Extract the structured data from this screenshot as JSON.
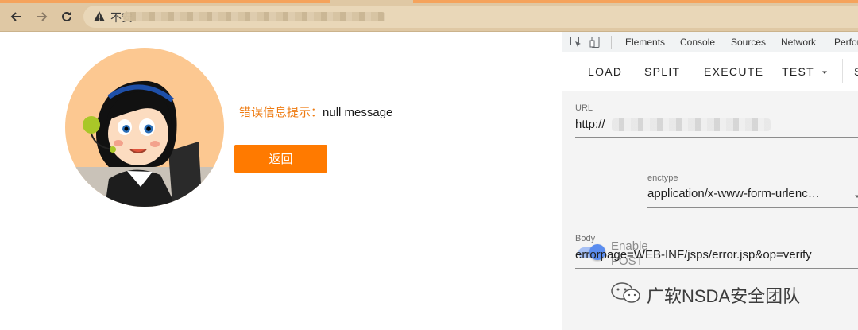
{
  "browser": {
    "back_icon": "arrow-left-icon",
    "forward_icon": "arrow-right-icon",
    "reload_icon": "reload-icon",
    "security_icon": "warning-icon",
    "security_label": "不安"
  },
  "page": {
    "error_label": "错误信息提示：",
    "error_message": "null message",
    "back_button": "返回"
  },
  "devtools": {
    "tabs": [
      "Elements",
      "Console",
      "Sources",
      "Network",
      "Perfor"
    ],
    "hackbar": {
      "buttons": [
        "LOAD",
        "SPLIT",
        "EXECUTE",
        "TEST",
        "S"
      ],
      "url_label": "URL",
      "url_value": "http://",
      "enable_post_label": "Enable POST",
      "enctype_label": "enctype",
      "enctype_value": "application/x-www-form-urlenc…",
      "body_label": "Body",
      "body_value": "errorpage=WEB-INF/jsps/error.jsp&op=verify",
      "enable_post_on": true
    }
  },
  "watermark": "广软NSDA安全团队",
  "colors": {
    "accent_orange": "#ff7a00",
    "error_label": "#ee7b12",
    "toggle_blue": "#5b8def"
  }
}
